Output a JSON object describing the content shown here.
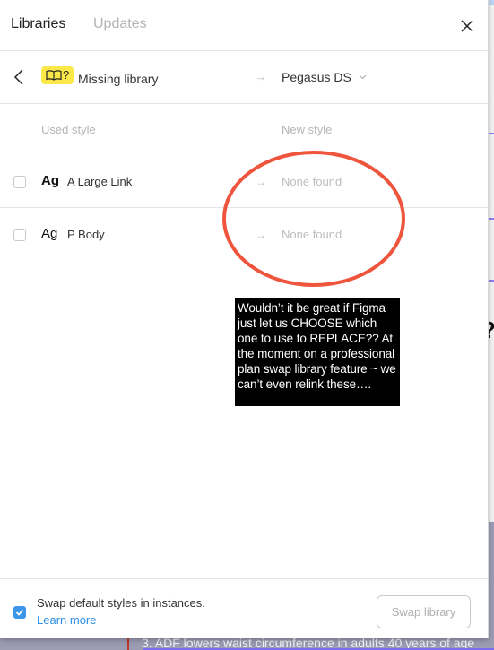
{
  "background": {
    "visible_text": "3. ADF lowers waist circumference in adults 40 years of age"
  },
  "header": {
    "tabs": [
      {
        "label": "Libraries",
        "active": true
      },
      {
        "label": "Updates",
        "active": false
      }
    ],
    "close_icon": "close-icon"
  },
  "library_row": {
    "back_icon": "chevron-left-icon",
    "badge_icon": "book-icon",
    "badge_suffix": "?",
    "source_label": "Missing library",
    "arrow": "→",
    "target_label": "Pegasus DS",
    "target_chevron": "chevron-down-icon",
    "badge_color": "#fde84a"
  },
  "columns": {
    "used_style": "Used style",
    "new_style": "New style"
  },
  "styles": [
    {
      "glyph": "Ag",
      "glyph_bold": true,
      "name": "A Large Link",
      "checked": false,
      "arrow": "→",
      "new_style": "None found"
    },
    {
      "glyph": "Ag",
      "glyph_bold": false,
      "name": "P Body",
      "checked": false,
      "arrow": "→",
      "new_style": "None found"
    }
  ],
  "annotation": {
    "ellipse_color": "#ef553d",
    "note_text": "Wouldn’t it be great if Figma just let us CHOOSE which one to use to REPLACE?? At the moment on a professional plan swap library feature ~ we can’t even relink these…."
  },
  "footer": {
    "checkbox_checked": true,
    "checkbox_label": "Swap default styles in instances.",
    "learn_more": "Learn more",
    "swap_button": "Swap library",
    "swap_button_enabled": false,
    "accent_color": "#3d97e8"
  }
}
